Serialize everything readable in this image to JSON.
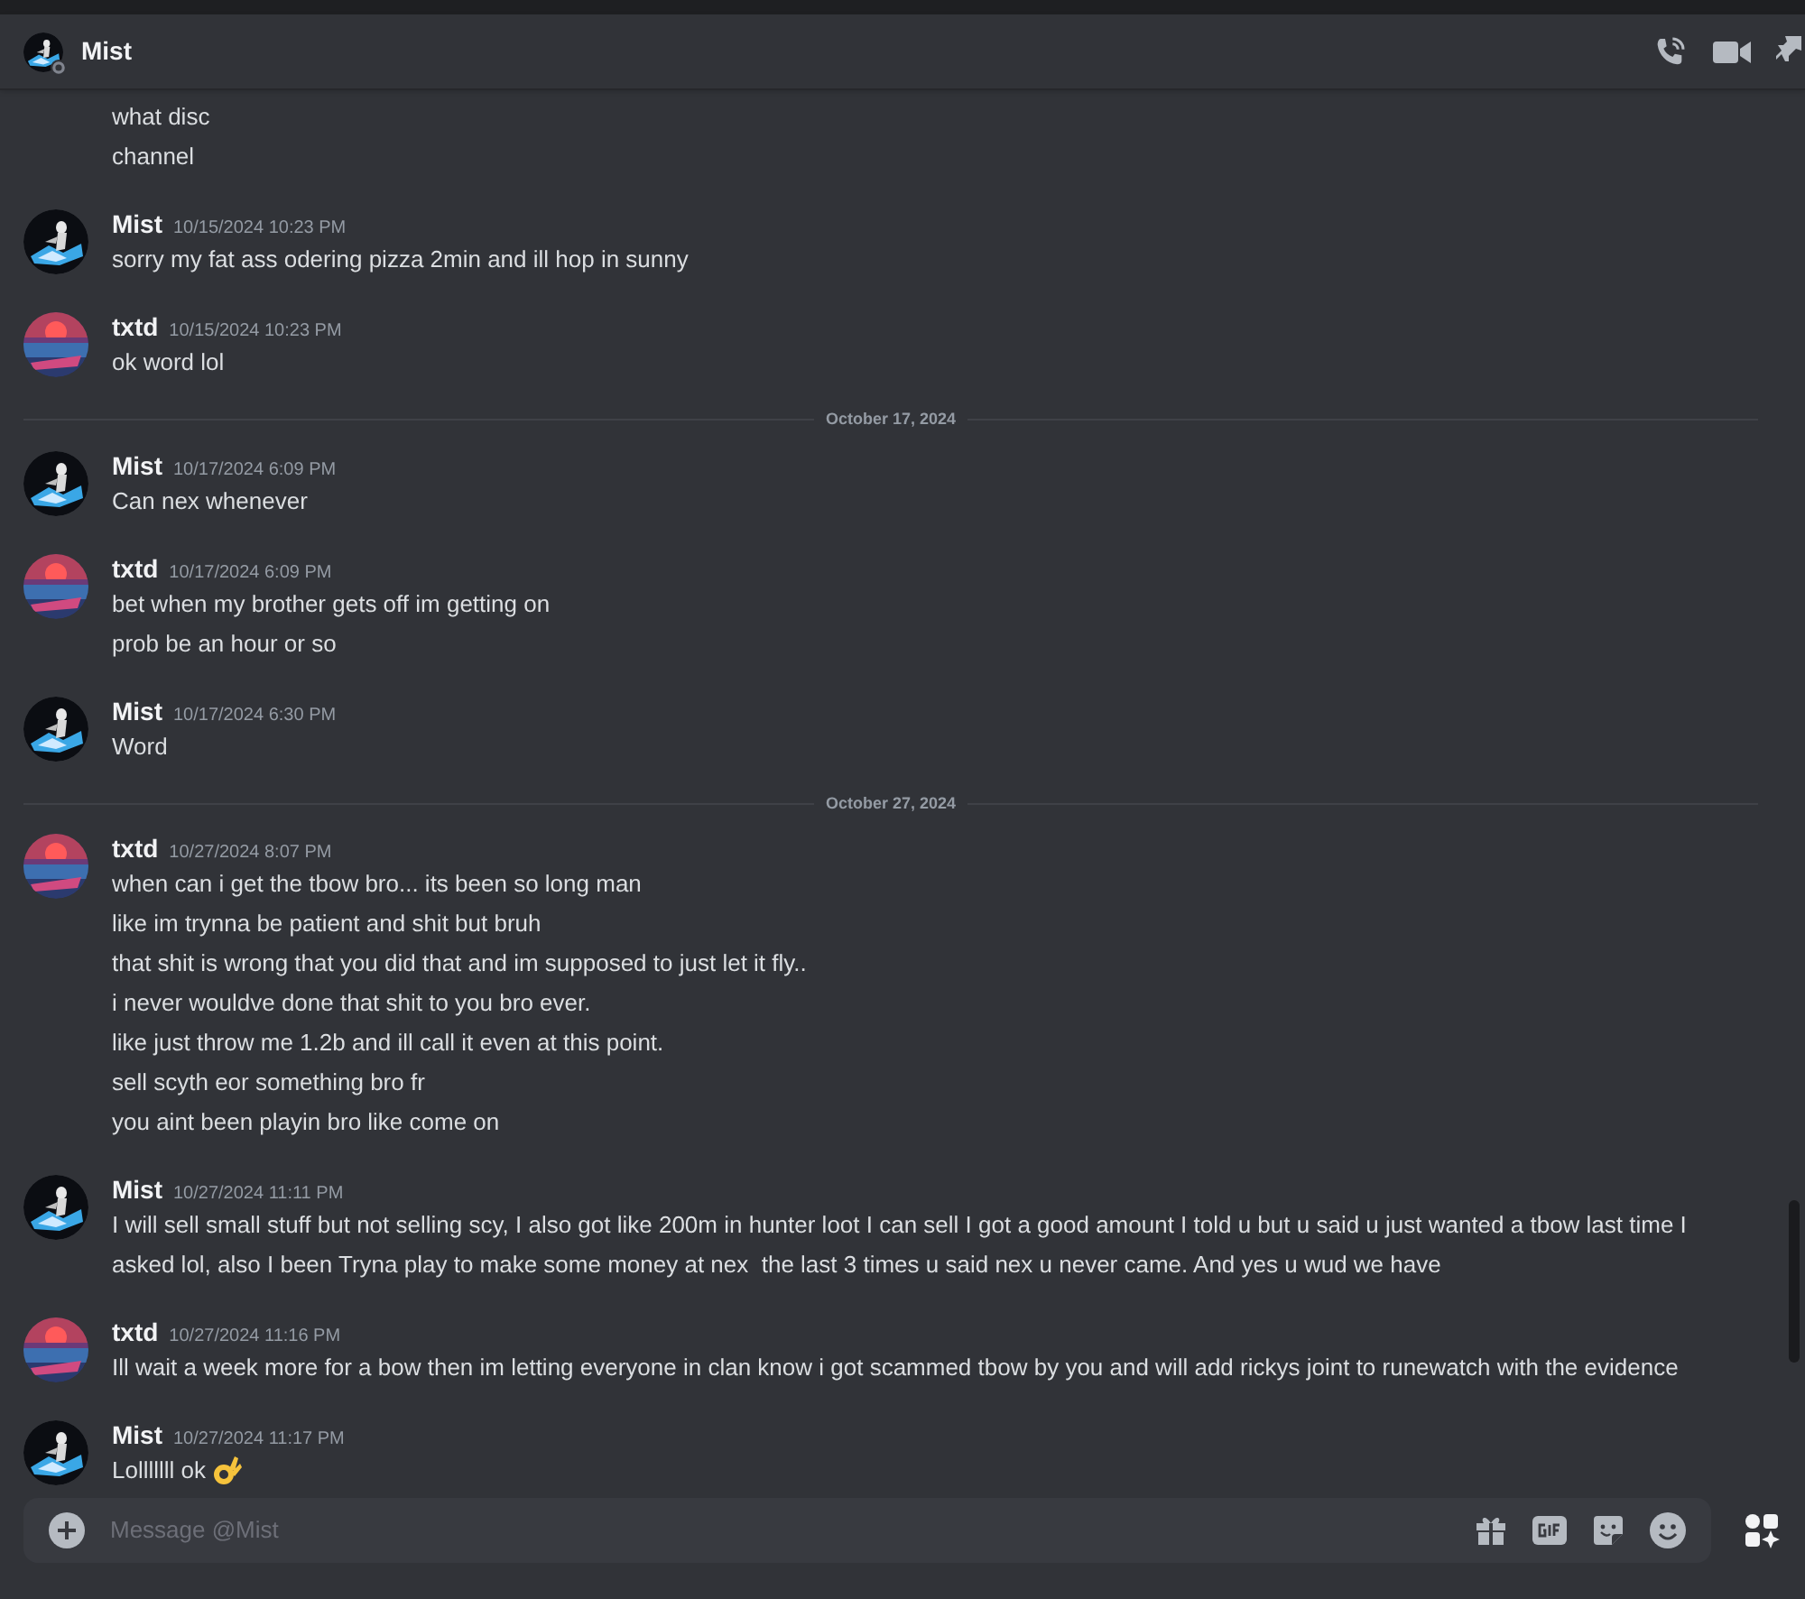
{
  "header": {
    "title": "Mist",
    "avatar": {
      "kind": "dark"
    }
  },
  "feed": [
    {
      "kind": "group",
      "continued": true,
      "lines": [
        "what disc",
        "channel"
      ]
    },
    {
      "kind": "group",
      "author": "Mist",
      "avatar": {
        "kind": "dark"
      },
      "time": "10/15/2024 10:23 PM",
      "lines": [
        "sorry my fat ass odering pizza 2min and ill hop in sunny"
      ]
    },
    {
      "kind": "group",
      "author": "txtd",
      "avatar": {
        "kind": "sunset"
      },
      "time": "10/15/2024 10:23 PM",
      "lines": [
        "ok word lol"
      ]
    },
    {
      "kind": "divider",
      "label": "October 17, 2024"
    },
    {
      "kind": "group",
      "author": "Mist",
      "avatar": {
        "kind": "dark"
      },
      "time": "10/17/2024 6:09 PM",
      "lines": [
        "Can nex whenever"
      ]
    },
    {
      "kind": "group",
      "author": "txtd",
      "avatar": {
        "kind": "sunset"
      },
      "time": "10/17/2024 6:09 PM",
      "lines": [
        "bet when my brother gets off im getting on",
        "prob be an hour or so"
      ]
    },
    {
      "kind": "group",
      "author": "Mist",
      "avatar": {
        "kind": "dark"
      },
      "time": "10/17/2024 6:30 PM",
      "lines": [
        "Word"
      ]
    },
    {
      "kind": "divider",
      "label": "October 27, 2024"
    },
    {
      "kind": "group",
      "author": "txtd",
      "avatar": {
        "kind": "sunset"
      },
      "time": "10/27/2024 8:07 PM",
      "lines": [
        "when can i get the tbow bro... its been so long man",
        "like im trynna be patient and shit but bruh",
        "that shit is wrong that you did that and im supposed to just let it fly..",
        "i never wouldve done that shit to you bro ever.",
        "like just throw me 1.2b and ill call it even at this point.",
        "sell scyth eor something bro fr",
        "you aint been playin bro like come on"
      ]
    },
    {
      "kind": "group",
      "author": "Mist",
      "avatar": {
        "kind": "dark"
      },
      "time": "10/27/2024 11:11 PM",
      "lines": [
        "I will sell small stuff but not selling scy, I also got like 200m in hunter loot I can sell I got a good amount I told u but u said u just wanted a tbow last time I asked lol, also I been Tryna play to make some money at nex  the last 3 times u said nex u never came. And yes u wud we have"
      ]
    },
    {
      "kind": "group",
      "author": "txtd",
      "avatar": {
        "kind": "sunset"
      },
      "time": "10/27/2024 11:16 PM",
      "lines": [
        "Ill wait a week more for a bow then im letting everyone in clan know i got scammed tbow by you and will add rickys joint to runewatch with the evidence"
      ]
    },
    {
      "kind": "group",
      "author": "Mist",
      "avatar": {
        "kind": "dark"
      },
      "time": "10/27/2024 11:17 PM",
      "lines": [
        "Lolllllll ok"
      ],
      "ok_emoji": true
    }
  ],
  "composer": {
    "placeholder": "Message @Mist"
  }
}
